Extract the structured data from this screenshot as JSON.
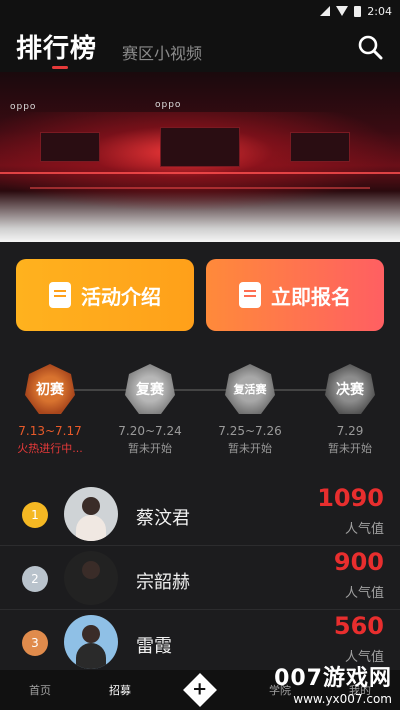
{
  "status_bar": {
    "time": "2:04"
  },
  "header": {
    "title": "排行榜",
    "subtitle_tab": "赛区小视频"
  },
  "banner": {
    "brand_1": "oppo",
    "brand_2": "oppo"
  },
  "cards": {
    "intro_label": "活动介绍",
    "signup_label": "立即报名"
  },
  "stages": [
    {
      "badge": "初赛",
      "date": "7.13~7.17",
      "status": "火热进行中..."
    },
    {
      "badge": "复赛",
      "date": "7.20~7.24",
      "status": "暂未开始"
    },
    {
      "badge": "复活赛",
      "date": "7.25~7.26",
      "status": "暂未开始"
    },
    {
      "badge": "决赛",
      "date": "7.29",
      "status": "暂未开始"
    }
  ],
  "rankings": [
    {
      "rank": "1",
      "name": "蔡汶君",
      "votes": "1090",
      "votes_label": "人气值"
    },
    {
      "rank": "2",
      "name": "宗韶赫",
      "votes": "900",
      "votes_label": "人气值"
    },
    {
      "rank": "3",
      "name": "雷霞",
      "votes": "560",
      "votes_label": "人气值"
    }
  ],
  "tabbar": {
    "home": "首页",
    "recruit": "招募",
    "academy": "学院",
    "mine": "我的"
  },
  "watermark": {
    "title": "007游戏网",
    "url": "www.yx007.com"
  },
  "colors": {
    "accent": "#e63a3a",
    "intro_card": "#ffa01a",
    "signup_card": "#ff5f62",
    "votes": "#e82e2e"
  }
}
